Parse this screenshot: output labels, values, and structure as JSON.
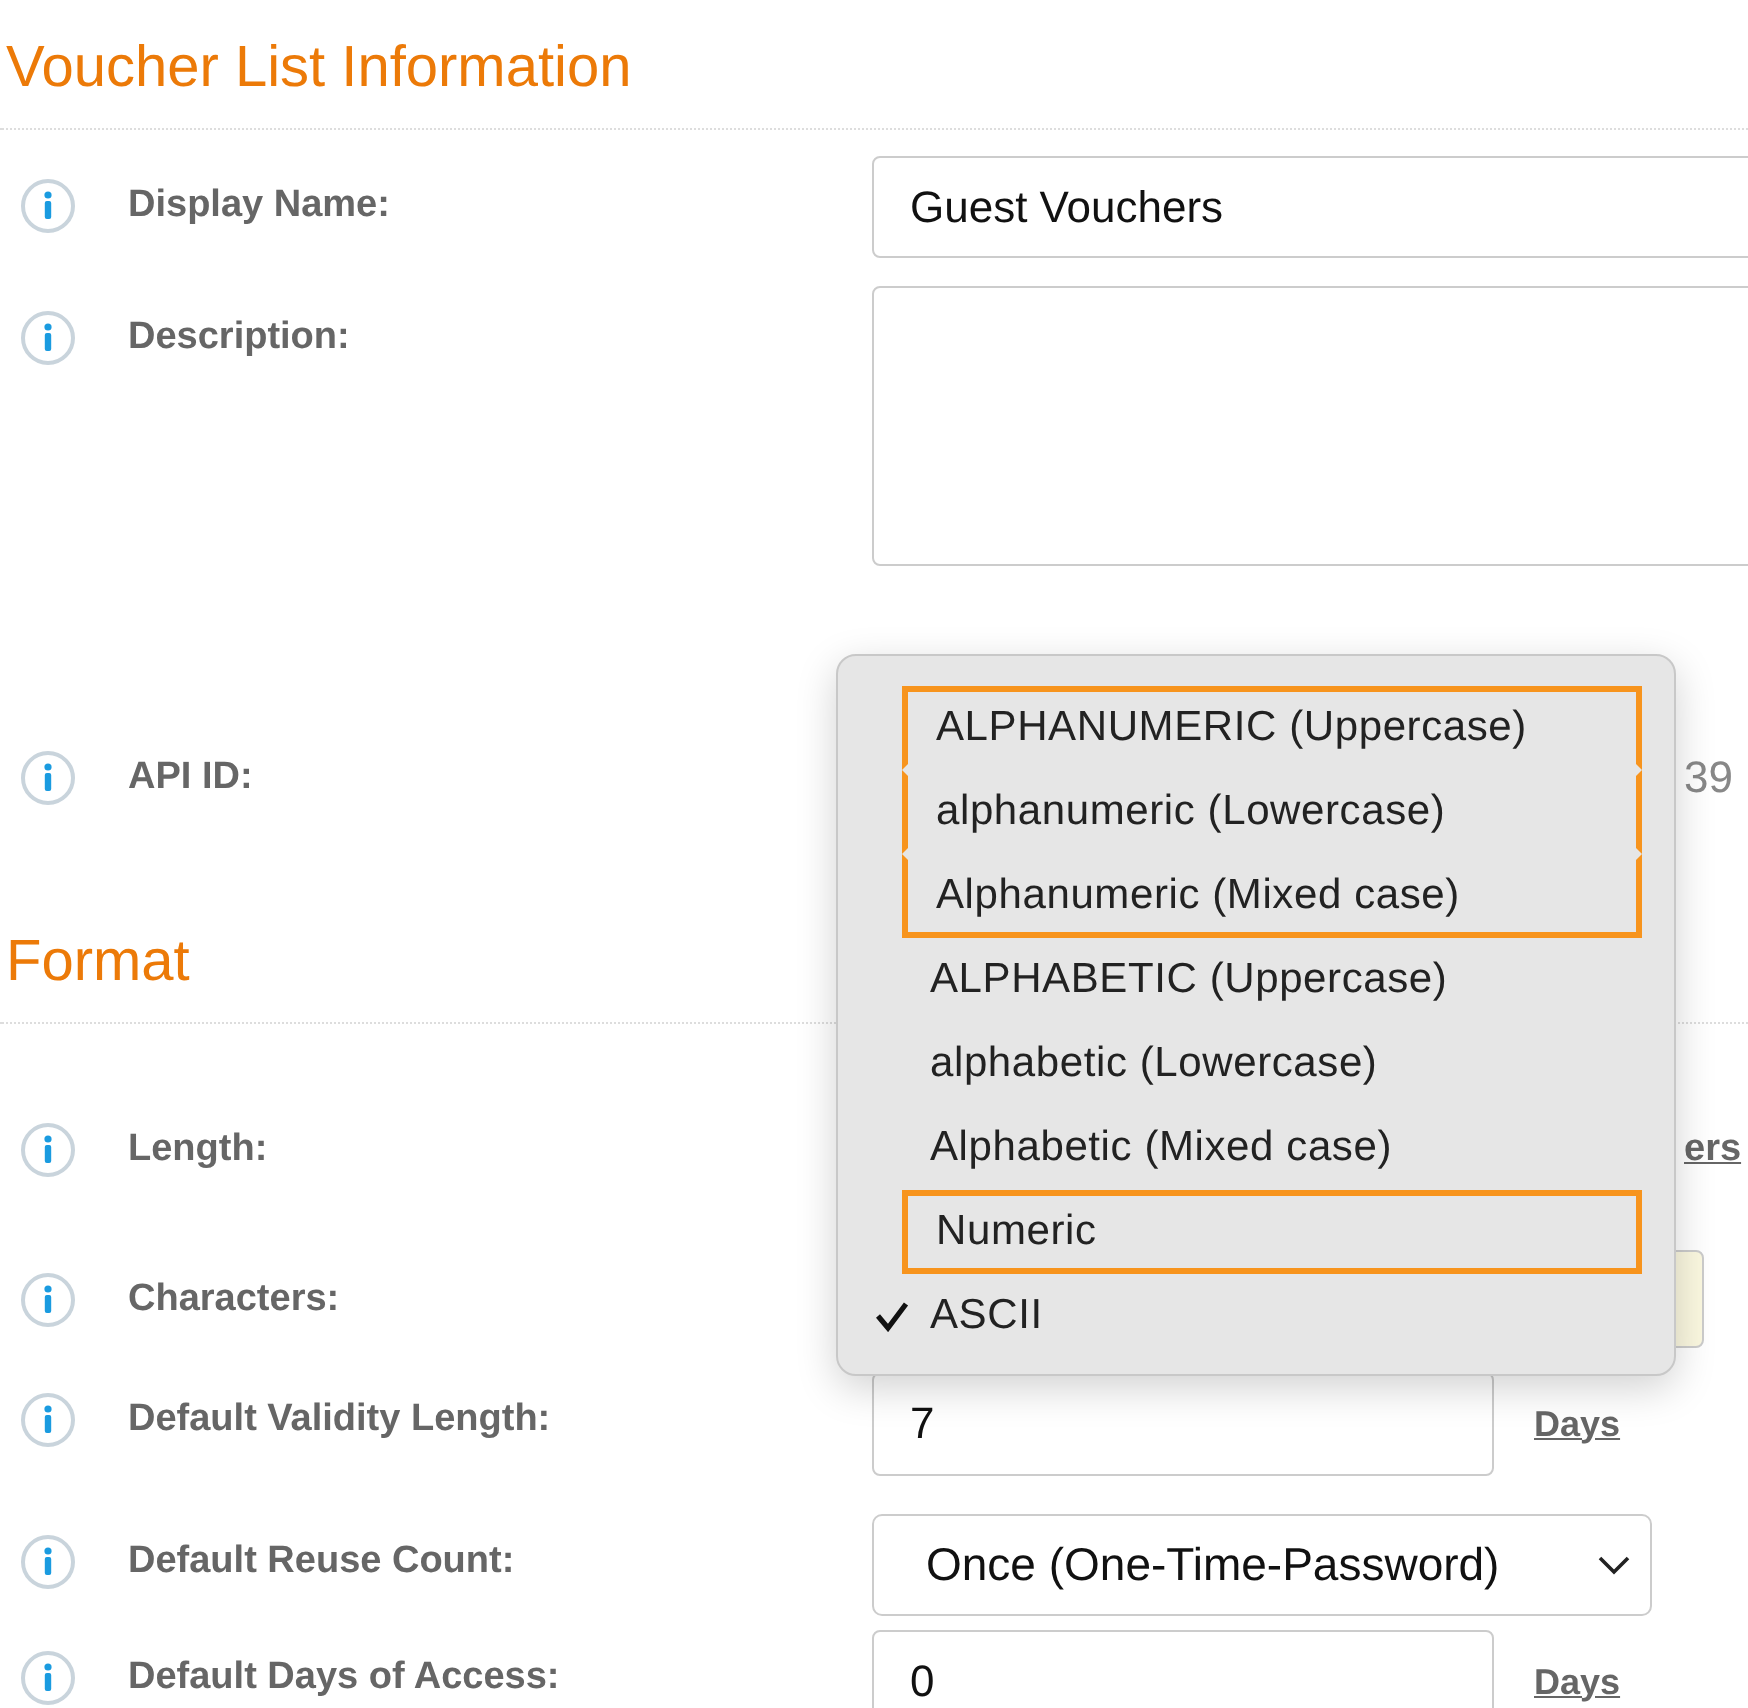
{
  "sections": [
    {
      "title": "Voucher List Information",
      "rows": [
        {
          "kind": "input",
          "label": "Display Name:",
          "value": "Guest Vouchers"
        },
        {
          "kind": "textarea",
          "label": "Description:"
        },
        {
          "kind": "text",
          "label": "API ID:",
          "value": "39"
        }
      ]
    },
    {
      "title": "Format",
      "rows": [
        {
          "kind": "link",
          "label": "Length:",
          "link": "ers"
        },
        {
          "kind": "select-hidden",
          "label": "Characters:"
        },
        {
          "kind": "input-unit",
          "label": "Default Validity Length:",
          "value": "7",
          "unit": "Days"
        },
        {
          "kind": "select",
          "label": "Default Reuse Count:",
          "value": "Once (One-Time-Password)"
        },
        {
          "kind": "input-unit",
          "label": "Default Days of Access:",
          "value": "0",
          "unit": "Days"
        }
      ]
    }
  ],
  "menu": {
    "items": [
      {
        "label": "ALPHANUMERIC (Uppercase)",
        "checked": false,
        "highlighted": true
      },
      {
        "label": "alphanumeric (Lowercase)",
        "checked": false,
        "highlighted": true
      },
      {
        "label": "Alphanumeric (Mixed case)",
        "checked": false,
        "highlighted": true
      },
      {
        "label": "ALPHABETIC (Uppercase)",
        "checked": false,
        "highlighted": false
      },
      {
        "label": "alphabetic (Lowercase)",
        "checked": false,
        "highlighted": false
      },
      {
        "label": "Alphabetic (Mixed case)",
        "checked": false,
        "highlighted": false
      },
      {
        "label": "Numeric",
        "checked": false,
        "highlighted": true
      },
      {
        "label": "ASCII",
        "checked": true,
        "highlighted": false
      }
    ]
  }
}
